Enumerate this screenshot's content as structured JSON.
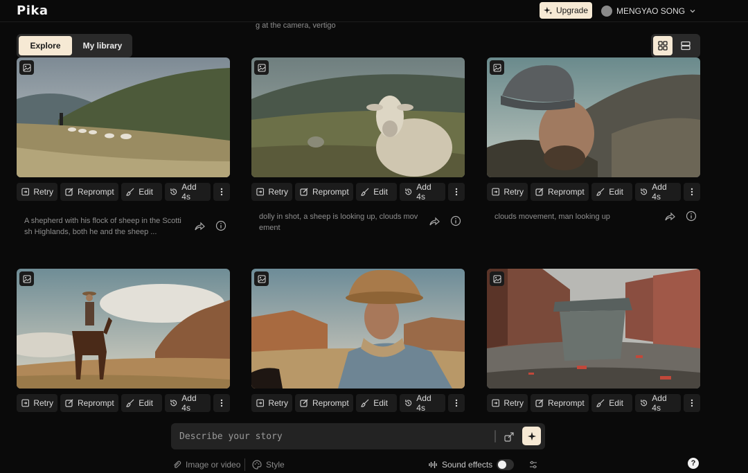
{
  "app": {
    "logo": "Pika"
  },
  "header": {
    "upgrade_label": "Upgrade",
    "user_name": "MENGYAO SONG"
  },
  "stray_caption": "g at the camera, vertigo",
  "tabs": [
    {
      "label": "Explore",
      "active": true
    },
    {
      "label": "My library",
      "active": false
    }
  ],
  "view_modes": [
    {
      "icon": "grid-icon",
      "active": true
    },
    {
      "icon": "list-icon",
      "active": false
    }
  ],
  "actions": {
    "retry": "Retry",
    "reprompt": "Reprompt",
    "edit": "Edit",
    "add": "Add 4s"
  },
  "cards": [
    {
      "scene": "shepherd-highlands",
      "caption": "A shepherd with his flock of sheep in the Scottish Highlands, both he and the sheep ..."
    },
    {
      "scene": "sheep-closeup",
      "caption": "dolly in shot, a sheep is looking up, clouds movement"
    },
    {
      "scene": "man-beanie",
      "caption": "clouds movement, man looking up"
    },
    {
      "scene": "cowboy-horse-desert",
      "caption": ""
    },
    {
      "scene": "cowboy-portrait",
      "caption": ""
    },
    {
      "scene": "dumpster-street",
      "caption": ""
    }
  ],
  "prompt": {
    "placeholder": "Describe your story"
  },
  "bottom_options": {
    "image_or_video": "Image or video",
    "style": "Style",
    "sound_effects": "Sound effects",
    "sound_effects_on": false
  },
  "help_label": "?",
  "colors": {
    "background": "#0a0a0a",
    "accent": "#f6e9d4",
    "panel": "#2a2a2a",
    "button": "#1c1c1c"
  }
}
